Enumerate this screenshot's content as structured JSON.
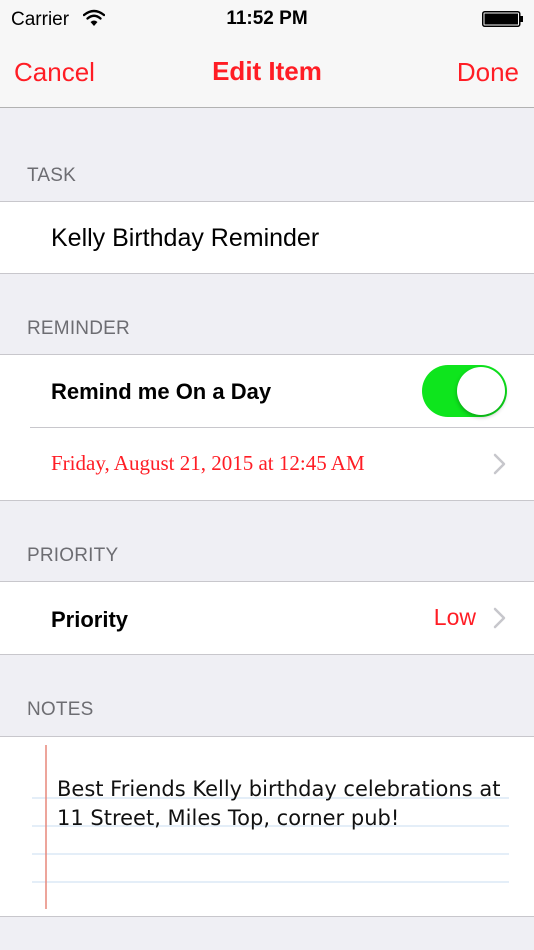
{
  "status": {
    "carrier": "Carrier",
    "time": "11:52 PM"
  },
  "nav": {
    "cancel": "Cancel",
    "title": "Edit Item",
    "done": "Done"
  },
  "task": {
    "header": "TASK",
    "value": "Kelly Birthday Reminder"
  },
  "reminder": {
    "header": "REMINDER",
    "toggle_label": "Remind me On a Day",
    "toggle_on": true,
    "date": "Friday, August 21, 2015 at 12:45 AM"
  },
  "priority": {
    "header": "PRIORITY",
    "label": "Priority",
    "value": "Low"
  },
  "notes": {
    "header": "NOTES",
    "text": "Best Friends Kelly birthday celebrations at 11 Street, Miles Top, corner pub!"
  },
  "colors": {
    "accent": "#ff1d25",
    "toggle_on": "#0ee51d",
    "background": "#efeff4"
  }
}
